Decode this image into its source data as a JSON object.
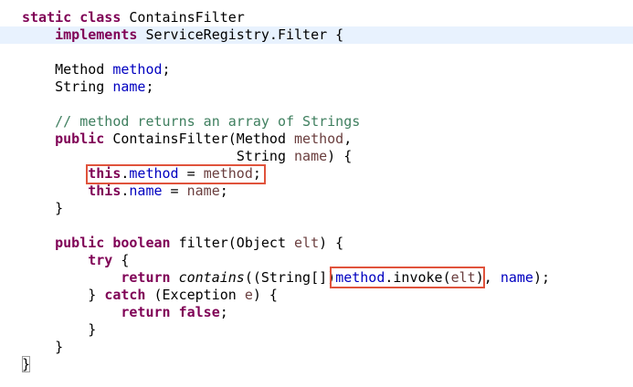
{
  "colors": {
    "keyword": "#7f0055",
    "field": "#0000c0",
    "parameter": "#6a3e3e",
    "comment": "#3f7f5f",
    "current_line": "#e8f2fe",
    "annotation_box": "#e0533c"
  },
  "code": {
    "l1_kw": "static class",
    "l1_text": " ContainsFilter",
    "l2_indent": "    ",
    "l2_kw": "implements",
    "l2_text": " ServiceRegistry.Filter {",
    "l3_indent": "    ",
    "l3_type": "Method ",
    "l3_field": "method",
    "l3_end": ";",
    "l4_indent": "    ",
    "l4_type": "String ",
    "l4_field": "name",
    "l4_end": ";",
    "l5_indent": "    ",
    "l5_comment": "// method returns an array of Strings",
    "l6_indent": "    ",
    "l6_kw": "public",
    "l6_text": " ContainsFilter(Method ",
    "l6_param": "method",
    "l6_end": ",",
    "l7_indent": "                          ",
    "l7_type": "String ",
    "l7_param": "name",
    "l7_end": ") {",
    "l8_indent": "        ",
    "l8_kw": "this",
    "l8_dot": ".",
    "l8_field": "method",
    "l8_eq": " = ",
    "l8_param": "method",
    "l8_end": ";",
    "l9_indent": "        ",
    "l9_kw": "this",
    "l9_dot": ".",
    "l9_field": "name",
    "l9_eq": " = ",
    "l9_param": "name",
    "l9_end": ";",
    "l10_indent": "    ",
    "l10_text": "}",
    "l11_indent": "    ",
    "l11_kw1": "public",
    "l11_sp": " ",
    "l11_kw2": "boolean",
    "l11_text": " filter(Object ",
    "l11_param": "elt",
    "l11_end": ") {",
    "l12_indent": "        ",
    "l12_kw": "try",
    "l12_end": " {",
    "l13_indent": "            ",
    "l13_kw": "return",
    "l13_sp": " ",
    "l13_method": "contains",
    "l13_cast": "((String[])",
    "l13_field": "method",
    "l13_invoke": ".invoke(",
    "l13_param": "elt",
    "l13_close": ")",
    "l13_comma": ", ",
    "l13_field2": "name",
    "l13_end": ");",
    "l14_indent": "        ",
    "l14_open": "} ",
    "l14_kw": "catch",
    "l14_text": " (Exception ",
    "l14_param": "e",
    "l14_end": ") {",
    "l15_indent": "            ",
    "l15_kw1": "return",
    "l15_sp": " ",
    "l15_kw2": "false",
    "l15_end": ";",
    "l16_indent": "        ",
    "l16_text": "}",
    "l17_indent": "    ",
    "l17_text": "}",
    "l18_text": "}"
  }
}
